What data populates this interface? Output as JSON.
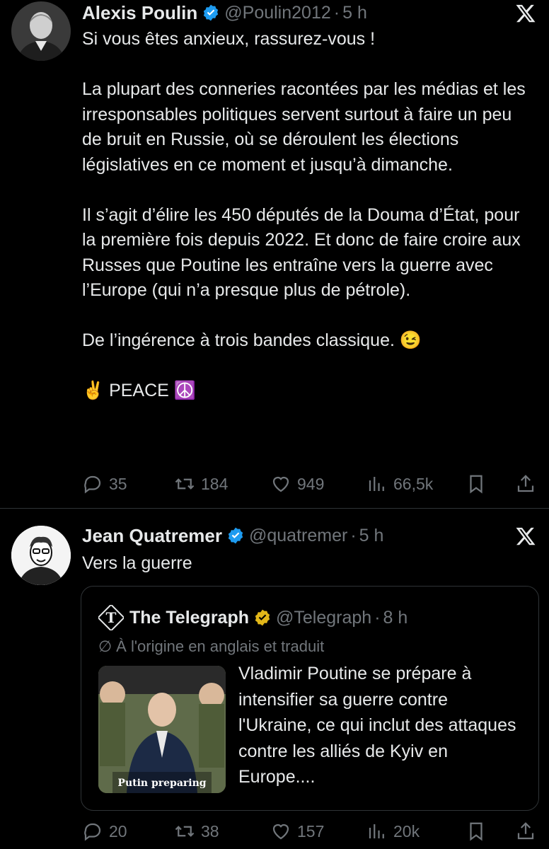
{
  "tweet1": {
    "name": "Alexis Poulin",
    "handle": "@Poulin2012",
    "time": "5 h",
    "paragraphs": [
      "Si vous êtes anxieux, rassurez-vous !",
      "La plupart des conneries racontées par les médias et les irresponsables politiques servent surtout à faire un peu de bruit en Russie, où se déroulent les élections législatives en ce moment et jusqu’à dimanche.",
      "Il s’agit d’élire les 450 députés de la Douma d’État, pour la première fois depuis 2022. Et donc de faire croire aux Russes que Poutine les entraîne vers la guerre avec l’Europe (qui n’a presque plus de pétrole).",
      "De l’ingérence à trois bandes classique. 😉",
      "✌️ PEACE ☮️"
    ],
    "replies": "35",
    "reposts": "184",
    "likes": "949",
    "views": "66,5k"
  },
  "tweet2": {
    "name": "Jean Quatremer",
    "handle": "@quatremer",
    "time": "5 h",
    "text": "Vers la guerre",
    "quote": {
      "name": "The Telegraph",
      "handle": "@Telegraph",
      "time": "8 h",
      "translated": "À l'origine en anglais et traduit",
      "image_caption": "Putin preparing",
      "text": "Vladimir Poutine se prépare à intensifier sa guerre contre l'Ukraine, ce qui inclut des attaques contre les alliés de Kyiv en Europe...."
    },
    "replies": "20",
    "reposts": "38",
    "likes": "157",
    "views": "20k"
  },
  "colors": {
    "background": "#000000",
    "text": "#e7e9ea",
    "muted": "#71767b",
    "verified_blue": "#1d9bf0",
    "verified_gold": "#e2b719",
    "divider": "#2f3336"
  }
}
